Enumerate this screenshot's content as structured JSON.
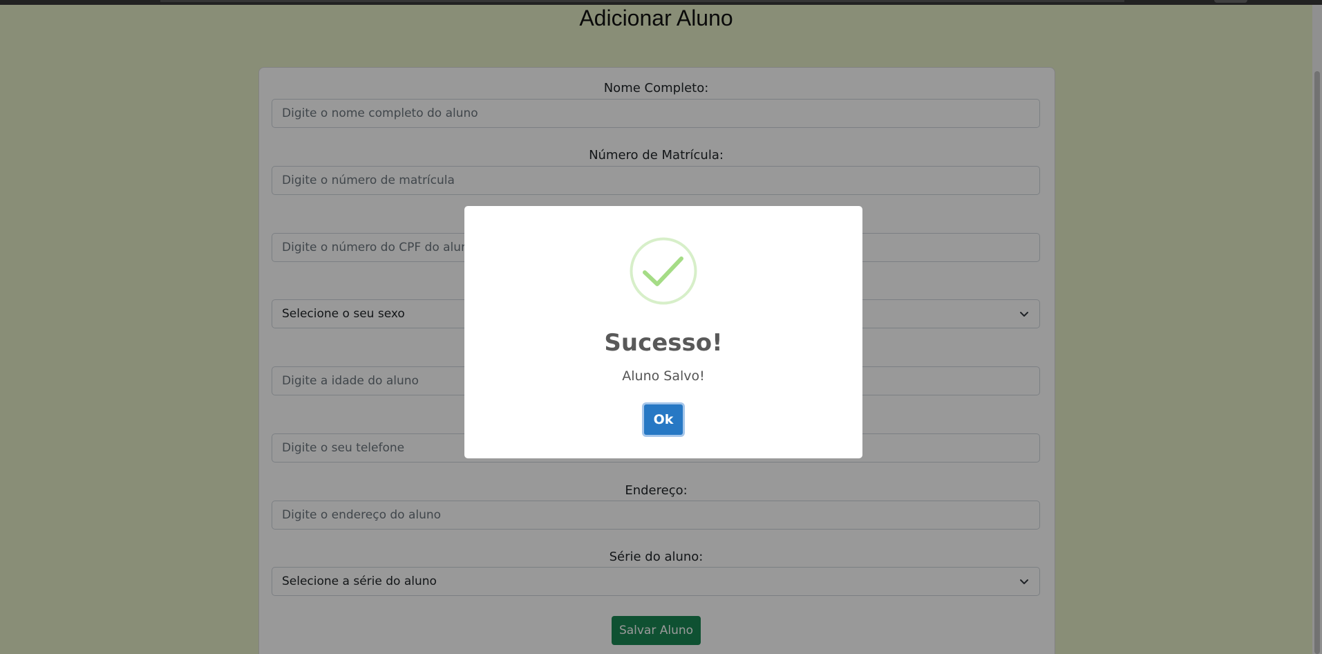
{
  "page": {
    "title": "Adicionar Aluno"
  },
  "form": {
    "fields": [
      {
        "label": "Nome Completo:",
        "placeholder": "Digite o nome completo do aluno"
      },
      {
        "label": "Número de Matrícula:",
        "placeholder": "Digite o número de matrícula"
      },
      {
        "label": "",
        "placeholder": "Digite o número do CPF do aluno"
      },
      {
        "label": "",
        "selected": "Selecione o seu sexo"
      },
      {
        "label": "",
        "placeholder": "Digite a idade do aluno"
      },
      {
        "label": "",
        "placeholder": "Digite o seu telefone"
      },
      {
        "label": "Endereço:",
        "placeholder": "Digite o endereço do aluno"
      },
      {
        "label": "Série do aluno:",
        "selected": "Selecione a série do aluno"
      }
    ],
    "submit_label": "Salvar Aluno"
  },
  "modal": {
    "icon": "success-check-icon",
    "title": "Sucesso!",
    "message": "Aluno Salvo!",
    "ok_label": "Ok"
  },
  "colors": {
    "background": "#e4edc7",
    "submit": "#198754",
    "ok_button": "#2778c4",
    "success_icon": "#a5dc86"
  }
}
